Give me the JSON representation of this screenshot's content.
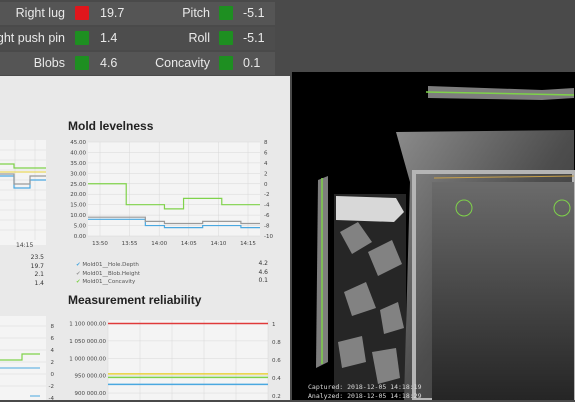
{
  "status": {
    "rows": [
      {
        "left_label": "Right lug",
        "left_status": "red",
        "left_value": "19.7",
        "right_label": "Pitch",
        "right_status": "green",
        "right_value": "-5.1"
      },
      {
        "left_label": "ight push pin",
        "left_status": "green",
        "left_value": "1.4",
        "right_label": "Roll",
        "right_status": "green",
        "right_value": "-5.1"
      },
      {
        "left_label": "Blobs",
        "left_status": "green",
        "left_value": "4.6",
        "right_label": "Concavity",
        "right_status": "green",
        "right_value": "0.1"
      }
    ]
  },
  "colors": {
    "alert": "#e0161c",
    "ok": "#1e8f21",
    "series_blue": "#4aa8e0",
    "series_gray": "#9a9a9a",
    "series_green": "#7fd24a",
    "series_red": "#e03a3a",
    "series_yellow": "#e8d23a"
  },
  "left_partial": {
    "x_tick": "14:15",
    "values": [
      "23.5",
      "19.7",
      "2.1",
      "1.4"
    ]
  },
  "mold_levelness": {
    "title": "Mold levelness",
    "chart_data": {
      "type": "line",
      "x": [
        "13:50",
        "13:55",
        "14:00",
        "14:05",
        "14:10",
        "14:15"
      ],
      "y_left_ticks": [
        "45.00",
        "40.00",
        "35.00",
        "30.00",
        "25.00",
        "20.00",
        "15.00",
        "10.00",
        "5.00",
        "0.00"
      ],
      "y_right_ticks": [
        "8",
        "6",
        "4",
        "2",
        "0",
        "-2",
        "-4",
        "-6",
        "-8",
        "-10"
      ],
      "ylim_left": [
        0,
        45
      ],
      "ylim_right": [
        -10,
        8
      ],
      "series": [
        {
          "name": "Mold01__Hole.Depth",
          "color": "#4aa8e0",
          "values": [
            8,
            8,
            8,
            5,
            4,
            4,
            5,
            5,
            4
          ]
        },
        {
          "name": "Mold01__Blob.Height",
          "color": "#9a9a9a",
          "values": [
            9,
            9,
            9,
            7,
            6,
            6,
            7,
            7,
            6
          ]
        },
        {
          "name": "Mold01__Concavity",
          "color": "#7fd24a",
          "values": [
            25,
            25,
            15,
            15,
            13,
            18,
            18,
            15,
            15
          ]
        }
      ],
      "legend_values": [
        "4.2",
        "4.6",
        "0.1"
      ]
    }
  },
  "measurement_reliability": {
    "title": "Measurement reliability",
    "left_ticks": [
      "8",
      "6",
      "4",
      "2",
      "0",
      "-2",
      "-4"
    ],
    "chart_data": {
      "type": "line",
      "y_left_ticks": [
        "1 100 000.00",
        "1 050 000.00",
        "1 000 000.00",
        "950 000.00",
        "900 000.00"
      ],
      "y_right_ticks": [
        "1",
        "0.8",
        "0.6",
        "0.4",
        "0.2"
      ],
      "ylim_left": [
        880000,
        1110000
      ],
      "series": [
        {
          "name": "",
          "color": "#e03a3a",
          "values": [
            1100000,
            1100000
          ]
        },
        {
          "name": "",
          "color": "#e8d23a",
          "values": [
            955000,
            955000
          ]
        },
        {
          "name": "",
          "color": "#7fd24a",
          "values": [
            945000,
            945000
          ]
        },
        {
          "name": "",
          "color": "#4aa8e0",
          "values": [
            925000,
            925000
          ]
        }
      ]
    }
  },
  "viewer": {
    "captured": "Captured: 2018-12-05 14:18:19",
    "analyzed": "Analyzed: 2018-12-05 14:18:29"
  }
}
